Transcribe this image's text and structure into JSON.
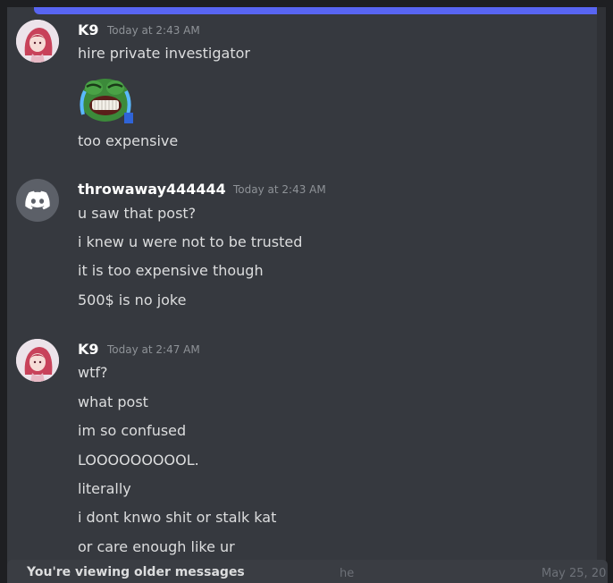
{
  "messages": [
    {
      "username": "K9",
      "timestamp": "Today at 2:43 AM",
      "avatar_icon": "anime-girl-avatar-icon",
      "lines": [
        "hire private investigator",
        "too expensive"
      ],
      "emoji_icon": "crying-laughing-pepe-emoji-icon"
    },
    {
      "username": "throwaway444444",
      "timestamp": "Today at 2:43 AM",
      "avatar_icon": "discord-default-avatar-icon",
      "lines": [
        "u saw that post?",
        "i knew u were not to be trusted",
        "it is too expensive though",
        "500$ is no joke"
      ]
    },
    {
      "username": "K9",
      "timestamp": "Today at 2:47 AM",
      "avatar_icon": "anime-girl-avatar-icon",
      "lines": [
        "wtf?",
        "what post",
        "im so confused",
        "LOOOOOOOOOL.",
        "literally",
        "i dont knwo shit or stalk kat",
        "or care enough like ur"
      ]
    }
  ],
  "footer": {
    "notice": "You're viewing older messages",
    "ghost_left": "he",
    "ghost_right": "May 25, 20"
  },
  "colors": {
    "background": "#36393f",
    "username": "#ffffff",
    "text": "#dcddde",
    "timestamp": "#8e9297",
    "accent": "#5865f2"
  }
}
